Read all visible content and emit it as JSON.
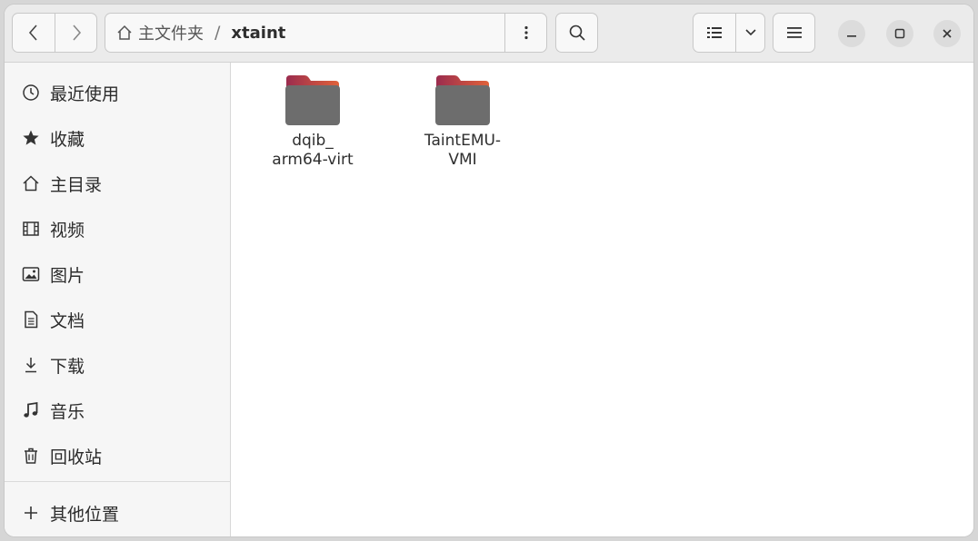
{
  "header": {
    "path": {
      "home_label": "主文件夹",
      "separator": "/",
      "current": "xtaint"
    }
  },
  "sidebar": {
    "items": [
      {
        "label": "最近使用",
        "icon": "clock-icon"
      },
      {
        "label": "收藏",
        "icon": "star-icon"
      },
      {
        "label": "主目录",
        "icon": "home-icon"
      },
      {
        "label": "视频",
        "icon": "film-icon"
      },
      {
        "label": "图片",
        "icon": "picture-icon"
      },
      {
        "label": "文档",
        "icon": "document-icon"
      },
      {
        "label": "下载",
        "icon": "download-icon"
      },
      {
        "label": "音乐",
        "icon": "music-icon"
      },
      {
        "label": "回收站",
        "icon": "trash-icon"
      }
    ],
    "other": {
      "label": "其他位置",
      "icon": "plus-icon"
    }
  },
  "content": {
    "folders": [
      {
        "name_line1": "dqib_",
        "name_line2": "arm64-virt"
      },
      {
        "name_line1": "TaintEMU-",
        "name_line2": "VMI"
      }
    ]
  },
  "colors": {
    "folder_body": "#6d6d6d",
    "folder_tab_left": "#9b2c4e",
    "folder_tab_right": "#e0623a"
  }
}
